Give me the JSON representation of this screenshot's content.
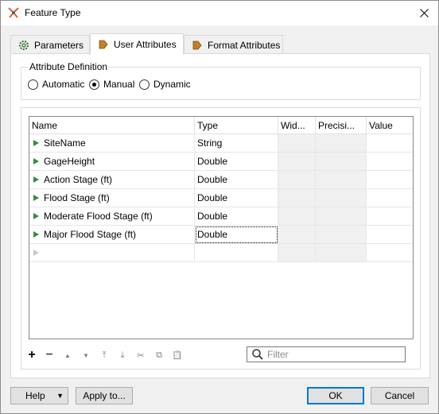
{
  "window": {
    "title": "Feature Type",
    "close_glyph": "✕"
  },
  "tabs": [
    {
      "label": "Parameters",
      "icon": "gear-icon",
      "active": false
    },
    {
      "label": "User Attributes",
      "icon": "arrow-tag-icon",
      "active": true
    },
    {
      "label": "Format Attributes",
      "icon": "arrow-tag-icon",
      "active": false
    }
  ],
  "attribute_definition": {
    "legend": "Attribute Definition",
    "options": [
      "Automatic",
      "Manual",
      "Dynamic"
    ],
    "selected": "Manual"
  },
  "table": {
    "columns": [
      "Name",
      "Type",
      "Wid...",
      "Precisi...",
      "Value"
    ],
    "rows": [
      {
        "name": "SiteName",
        "type": "String"
      },
      {
        "name": "GageHeight",
        "type": "Double"
      },
      {
        "name": "Action Stage (ft)",
        "type": "Double"
      },
      {
        "name": "Flood Stage (ft)",
        "type": "Double"
      },
      {
        "name": "Moderate Flood Stage (ft)",
        "type": "Double"
      },
      {
        "name": "Major Flood Stage (ft)",
        "type": "Double"
      }
    ]
  },
  "toolbar": {
    "add": "+",
    "remove": "−",
    "move_up": "▲",
    "move_down": "▼",
    "move_top": "⤒",
    "move_bottom": "⤓",
    "cut": "✂",
    "copy": "⧉",
    "paste": "📋"
  },
  "filter": {
    "placeholder": "Filter",
    "value": ""
  },
  "buttons": {
    "help": "Help",
    "help_arrow": "▼",
    "apply_to": "Apply to...",
    "ok": "OK",
    "cancel": "Cancel"
  },
  "colors": {
    "accent": "#0078d7",
    "row_arrow": "#3c8a3c"
  }
}
